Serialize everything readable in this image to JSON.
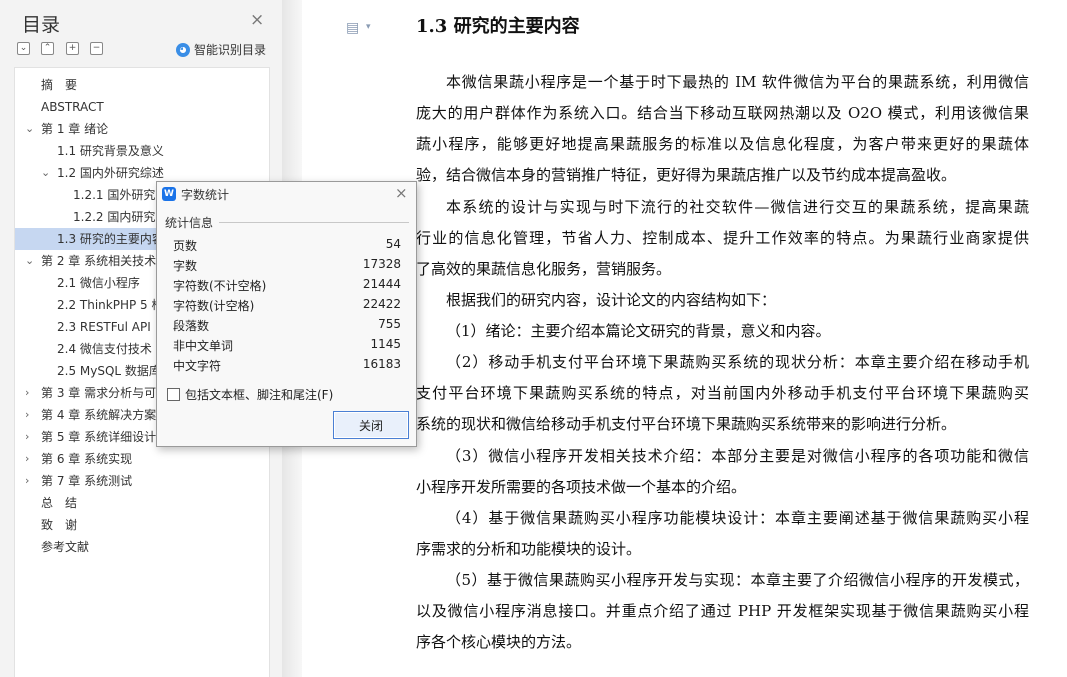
{
  "toc": {
    "title": "目录",
    "close": "×",
    "tool_buttons": [
      "⌄",
      "⌃",
      "+",
      "−"
    ],
    "smart_label": "智能识别目录",
    "items": [
      {
        "label": "摘　要",
        "level": 0,
        "arrow": ""
      },
      {
        "label": "ABSTRACT",
        "level": 0,
        "arrow": ""
      },
      {
        "label": "第 1 章  绪论",
        "level": 0,
        "arrow": "⌄"
      },
      {
        "label": "1.1  研究背景及意义",
        "level": 1,
        "arrow": ""
      },
      {
        "label": "1.2  国内外研究综述",
        "level": 1,
        "arrow": "⌄"
      },
      {
        "label": "1.2.1 国外研究现状",
        "level": 2,
        "arrow": ""
      },
      {
        "label": "1.2.2 国内研究现状",
        "level": 2,
        "arrow": ""
      },
      {
        "label": "1.3  研究的主要内容",
        "level": 1,
        "arrow": "",
        "selected": true
      },
      {
        "label": "第 2 章  系统相关技术",
        "level": 0,
        "arrow": "⌄"
      },
      {
        "label": "2.1  微信小程序",
        "level": 1,
        "arrow": ""
      },
      {
        "label": "2.2 ThinkPHP 5  框架",
        "level": 1,
        "arrow": ""
      },
      {
        "label": "2.3 RESTFul API",
        "level": 1,
        "arrow": ""
      },
      {
        "label": "2.4  微信支付技术",
        "level": 1,
        "arrow": ""
      },
      {
        "label": "2.5 MySQL 数据库",
        "level": 1,
        "arrow": ""
      },
      {
        "label": "第 3 章  需求分析与可行性",
        "level": 0,
        "arrow": "›"
      },
      {
        "label": "第 4 章  系统解决方案",
        "level": 0,
        "arrow": "›"
      },
      {
        "label": "第 5 章  系统详细设计",
        "level": 0,
        "arrow": "›"
      },
      {
        "label": "第 6 章  系统实现",
        "level": 0,
        "arrow": "›"
      },
      {
        "label": "第 7 章  系统测试",
        "level": 0,
        "arrow": "›"
      },
      {
        "label": "总　结",
        "level": 0,
        "arrow": ""
      },
      {
        "label": "致　谢",
        "level": 0,
        "arrow": ""
      },
      {
        "label": "参考文献",
        "level": 0,
        "arrow": ""
      }
    ]
  },
  "document": {
    "heading": "1.3  研究的主要内容",
    "lines": [
      {
        "text": "本微信果蔬小程序是一个基于时下最热的 IM 软件微信为平台的果蔬系统，利用微信",
        "indent": true,
        "justify": true
      },
      {
        "text": "庞大的用户群体作为系统入口。结合当下移动互联网热潮以及 O2O 模式，利用该微信果",
        "indent": false,
        "justify": true
      },
      {
        "text": "蔬小程序，能够更好地提高果蔬服务的标准以及信息化程度，为客户带来更好的果蔬体",
        "indent": false,
        "justify": true
      },
      {
        "text": "验，结合微信本身的营销推广特征，更好得为果蔬店推广以及节约成本提高盈收。",
        "indent": false,
        "justify": false
      },
      {
        "text": "本系统的设计与实现与时下流行的社交软件—微信进行交互的果蔬系统，提高果蔬",
        "indent": true,
        "justify": true
      },
      {
        "text": "行业的信息化管理，节省人力、控制成本、提升工作效率的特点。为果蔬行业商家提供",
        "indent": false,
        "justify": true
      },
      {
        "text": "了高效的果蔬信息化服务，营销服务。",
        "indent": false,
        "justify": false
      },
      {
        "text": "根据我们的研究内容，设计论文的内容结构如下：",
        "indent": true,
        "justify": false
      },
      {
        "text": "（1）绪论：主要介绍本篇论文研究的背景，意义和内容。",
        "indent": true,
        "justify": false
      },
      {
        "text": "（2）移动手机支付平台环境下果蔬购买系统的现状分析：本章主要介绍在移动手机",
        "indent": true,
        "justify": true
      },
      {
        "text": "支付平台环境下果蔬购买系统的特点，对当前国内外移动手机支付平台环境下果蔬购买",
        "indent": false,
        "justify": true
      },
      {
        "text": "系统的现状和微信给移动手机支付平台环境下果蔬购买系统带来的影响进行分析。",
        "indent": false,
        "justify": false
      },
      {
        "text": "（3）微信小程序开发相关技术介绍：本部分主要是对微信小程序的各项功能和微信",
        "indent": true,
        "justify": true
      },
      {
        "text": "小程序开发所需要的各项技术做一个基本的介绍。",
        "indent": false,
        "justify": false
      },
      {
        "text": "（4）基于微信果蔬购买小程序功能模块设计：本章主要阐述基于微信果蔬购买小程",
        "indent": true,
        "justify": true
      },
      {
        "text": "序需求的分析和功能模块的设计。",
        "indent": false,
        "justify": false
      },
      {
        "text": "（5）基于微信果蔬购买小程序开发与实现：本章主要了介绍微信小程序的开发模式，",
        "indent": true,
        "justify": true
      },
      {
        "text": "以及微信小程序消息接口。并重点介绍了通过 PHP 开发框架实现基于微信果蔬购买小程",
        "indent": false,
        "justify": true
      },
      {
        "text": "序各个核心模块的方法。",
        "indent": false,
        "justify": false
      }
    ]
  },
  "dialog": {
    "title": "字数统计",
    "close": "×",
    "section": "统计信息",
    "stats": [
      {
        "label": "页数",
        "value": "54"
      },
      {
        "label": "字数",
        "value": "17328"
      },
      {
        "label": "字符数(不计空格)",
        "value": "21444"
      },
      {
        "label": "字符数(计空格)",
        "value": "22422"
      },
      {
        "label": "段落数",
        "value": "755"
      },
      {
        "label": "非中文单词",
        "value": "1145"
      },
      {
        "label": "中文字符",
        "value": "16183"
      }
    ],
    "checkbox_label": "包括文本框、脚注和尾注(F)",
    "checkbox_checked": false,
    "close_button": "关闭"
  }
}
